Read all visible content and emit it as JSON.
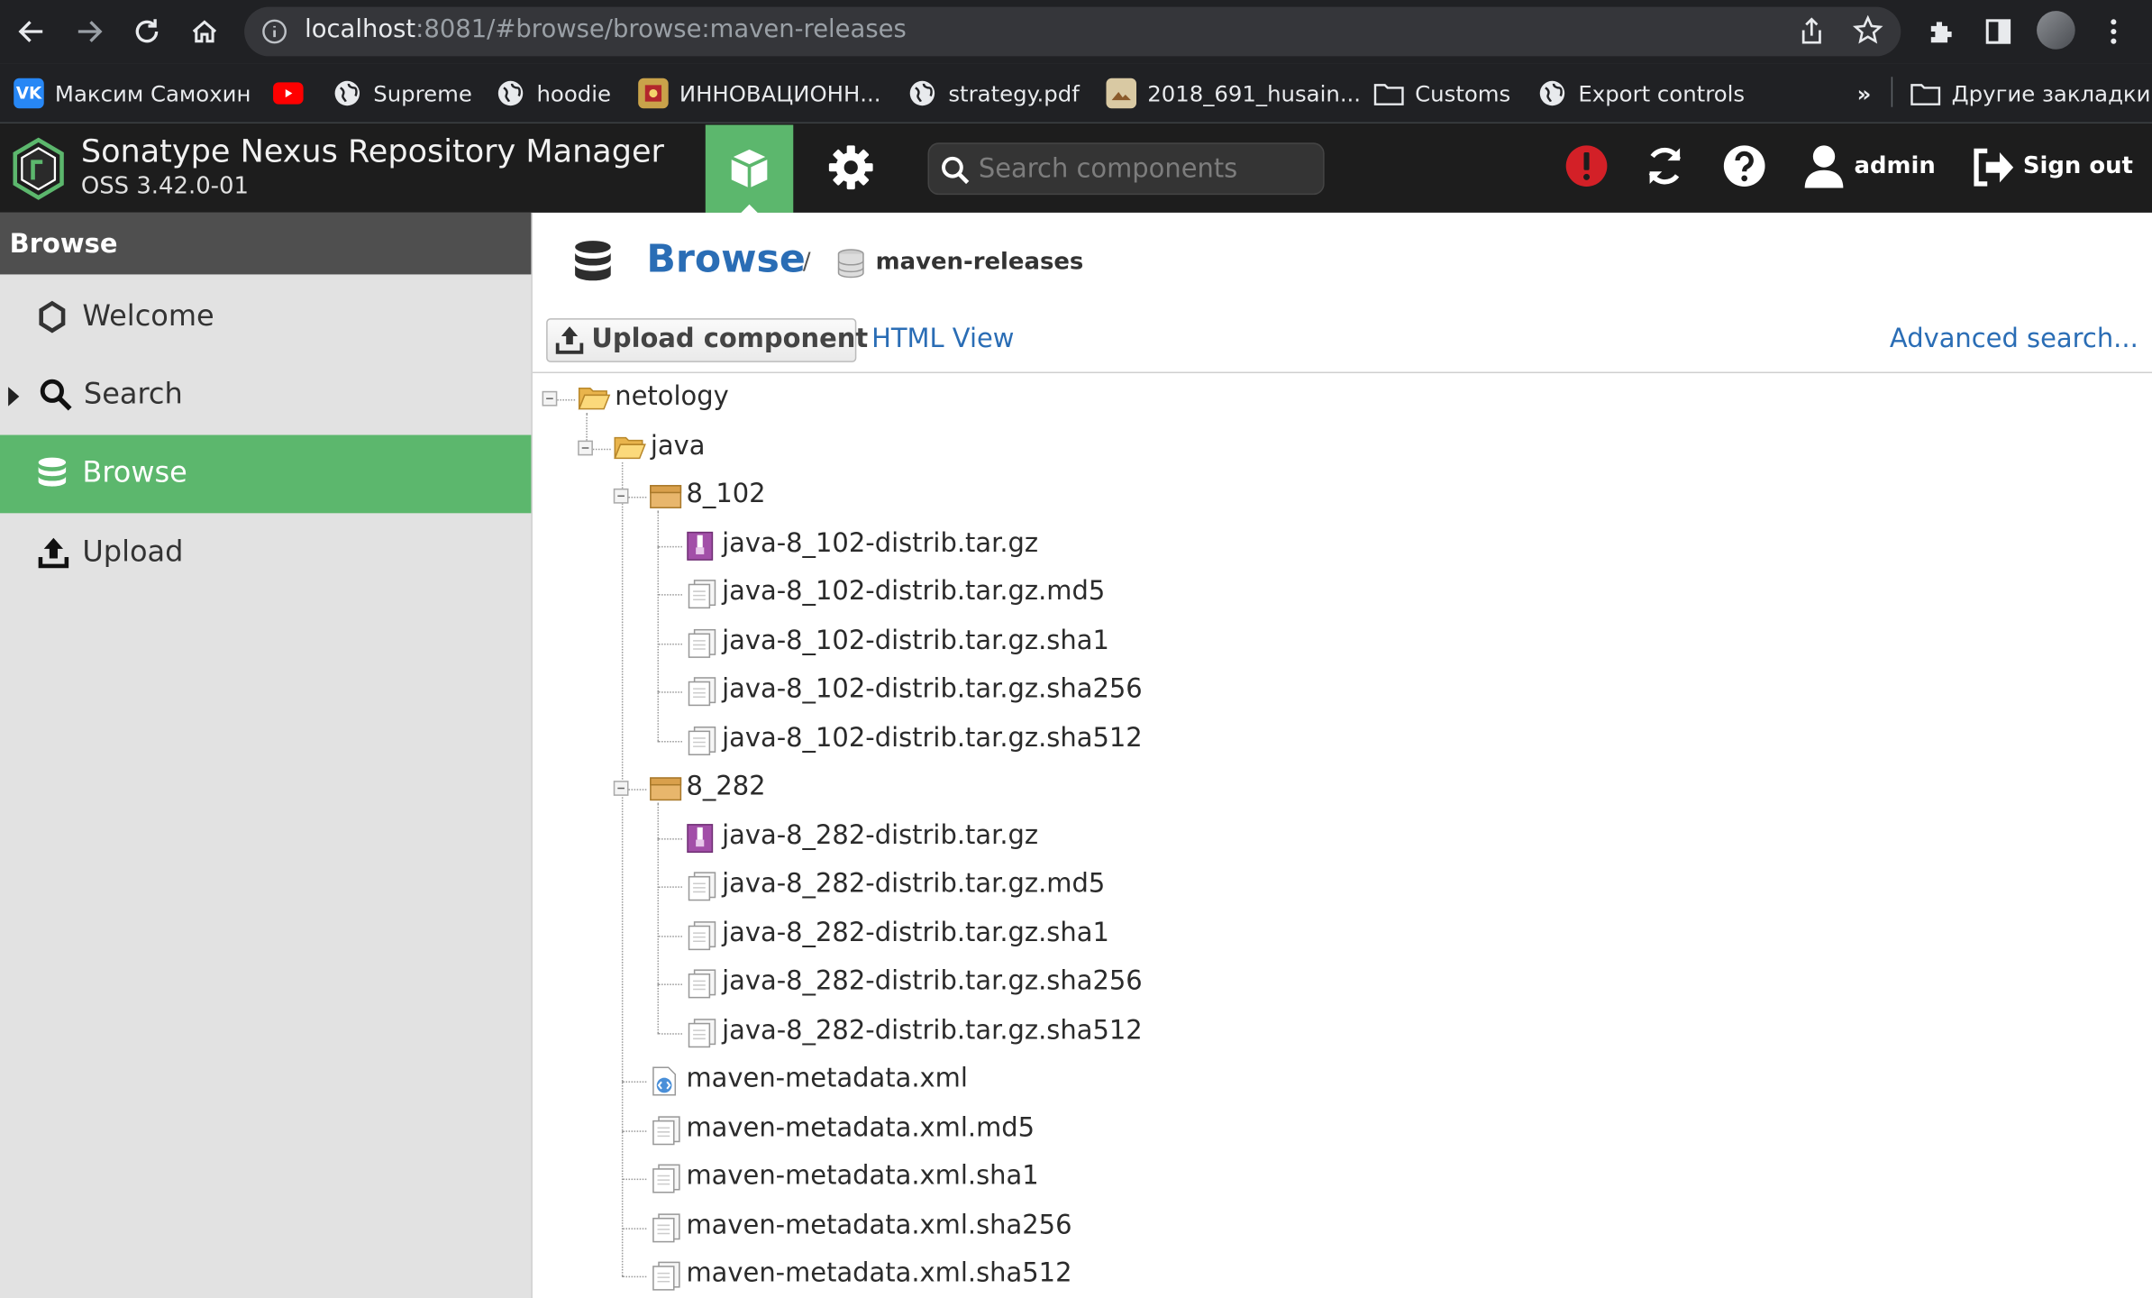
{
  "browser": {
    "url_host": "localhost",
    "url_path": ":8081/#browse/browse:maven-releases",
    "bookmarks": [
      {
        "label": "Максим Самохин",
        "icon": "vk-icon"
      },
      {
        "label": "",
        "icon": "youtube-icon"
      },
      {
        "label": "Supreme",
        "icon": "globe-icon"
      },
      {
        "label": "hoodie",
        "icon": "globe-icon"
      },
      {
        "label": "ИННОВАЦИОНН...",
        "icon": "emblem-icon"
      },
      {
        "label": "strategy.pdf",
        "icon": "globe-icon"
      },
      {
        "label": "2018_691_husain...",
        "icon": "image-icon"
      },
      {
        "label": "Customs",
        "icon": "folder-icon"
      },
      {
        "label": "Export controls",
        "icon": "globe-icon"
      }
    ],
    "more_bookmarks": "»",
    "other_bookmarks": "Другие закладки"
  },
  "header": {
    "title": "Sonatype Nexus Repository Manager",
    "version": "OSS 3.42.0-01",
    "search_placeholder": "Search components",
    "user": "admin",
    "signout": "Sign out"
  },
  "sidebar": {
    "heading": "Browse",
    "items": [
      {
        "label": "Welcome",
        "icon": "hexagon-icon",
        "active": false
      },
      {
        "label": "Search",
        "icon": "search-icon",
        "active": false
      },
      {
        "label": "Browse",
        "icon": "database-icon",
        "active": true
      },
      {
        "label": "Upload",
        "icon": "upload-icon",
        "active": false
      }
    ]
  },
  "main": {
    "breadcrumb_title": "Browse",
    "breadcrumb_sep": "/",
    "repository": "maven-releases",
    "upload_button": "Upload component",
    "html_view": "HTML View",
    "advanced_search": "Advanced search..."
  },
  "tree": [
    {
      "label": "netology",
      "type": "folder",
      "depth": 0
    },
    {
      "label": "java",
      "type": "folder",
      "depth": 1
    },
    {
      "label": "8_102",
      "type": "component",
      "depth": 2
    },
    {
      "label": "java-8_102-distrib.tar.gz",
      "type": "archive",
      "depth": 3
    },
    {
      "label": "java-8_102-distrib.tar.gz.md5",
      "type": "file",
      "depth": 3
    },
    {
      "label": "java-8_102-distrib.tar.gz.sha1",
      "type": "file",
      "depth": 3
    },
    {
      "label": "java-8_102-distrib.tar.gz.sha256",
      "type": "file",
      "depth": 3
    },
    {
      "label": "java-8_102-distrib.tar.gz.sha512",
      "type": "file",
      "depth": 3
    },
    {
      "label": "8_282",
      "type": "component",
      "depth": 2
    },
    {
      "label": "java-8_282-distrib.tar.gz",
      "type": "archive",
      "depth": 3
    },
    {
      "label": "java-8_282-distrib.tar.gz.md5",
      "type": "file",
      "depth": 3
    },
    {
      "label": "java-8_282-distrib.tar.gz.sha1",
      "type": "file",
      "depth": 3
    },
    {
      "label": "java-8_282-distrib.tar.gz.sha256",
      "type": "file",
      "depth": 3
    },
    {
      "label": "java-8_282-distrib.tar.gz.sha512",
      "type": "file",
      "depth": 3
    },
    {
      "label": "maven-metadata.xml",
      "type": "xml",
      "depth": 2
    },
    {
      "label": "maven-metadata.xml.md5",
      "type": "file",
      "depth": 2
    },
    {
      "label": "maven-metadata.xml.sha1",
      "type": "file",
      "depth": 2
    },
    {
      "label": "maven-metadata.xml.sha256",
      "type": "file",
      "depth": 2
    },
    {
      "label": "maven-metadata.xml.sha512",
      "type": "file",
      "depth": 2
    }
  ],
  "colors": {
    "accent": "#5cb76d",
    "link": "#2a6db5",
    "header_bg": "#1d1d1d",
    "alert": "#d32027"
  }
}
